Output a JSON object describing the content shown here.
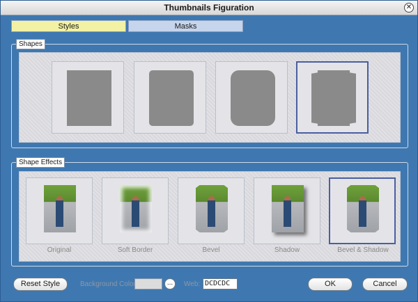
{
  "window": {
    "title": "Thumbnails Figuration",
    "close_glyph": "✕"
  },
  "tabs": {
    "styles": "Styles",
    "masks": "Masks"
  },
  "shapes": {
    "label": "Shapes",
    "items": [
      {
        "name": "rectangle"
      },
      {
        "name": "rounded-small"
      },
      {
        "name": "rounded-large"
      },
      {
        "name": "notched",
        "selected": true
      }
    ]
  },
  "shape_effects": {
    "label": "Shape Effects",
    "items": [
      {
        "label": "Original"
      },
      {
        "label": "Soft Border"
      },
      {
        "label": "Bevel"
      },
      {
        "label": "Shadow"
      },
      {
        "label": "Bevel & Shadow",
        "selected": true
      }
    ]
  },
  "footer": {
    "reset_label": "Reset Style",
    "bg_color_label": "Background Color:",
    "dots_label": "...",
    "web_label": "Web:",
    "web_value": "DCDCDC",
    "ok_label": "OK",
    "cancel_label": "Cancel"
  },
  "colors": {
    "background_color": "#DCDCDC",
    "frame": "#3F78B0",
    "active_tab": "#F3F1A3",
    "inactive_tab": "#C6D4EC",
    "selection": "#4A5EA0"
  }
}
